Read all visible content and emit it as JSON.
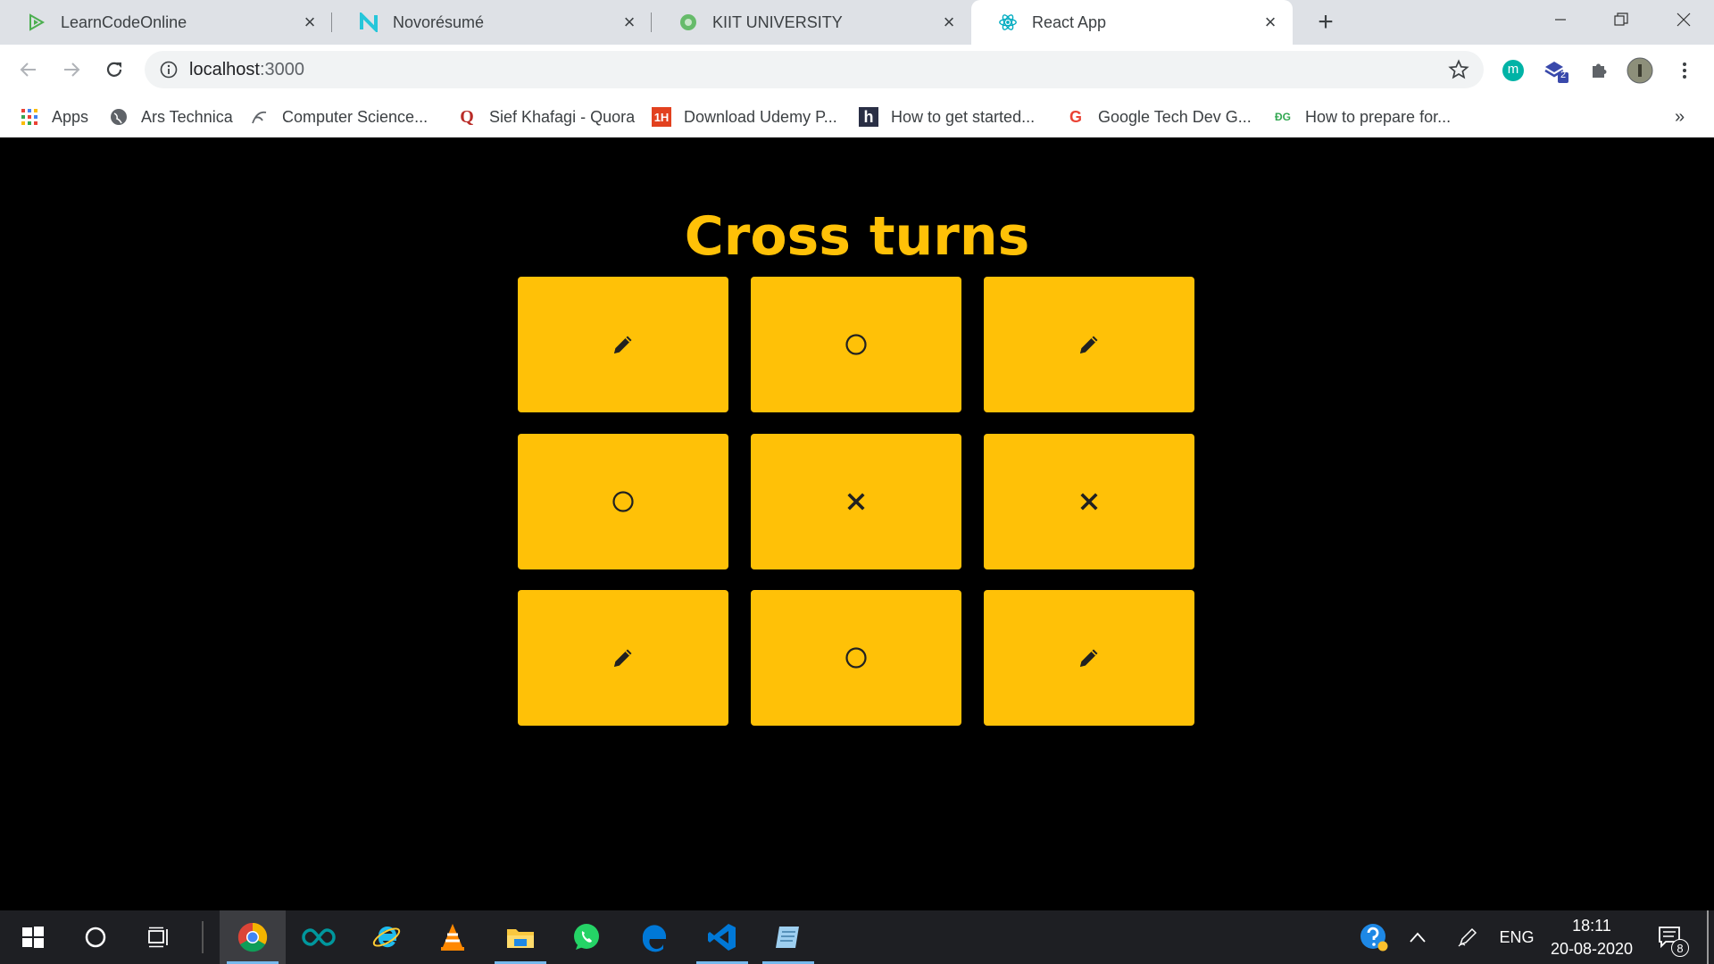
{
  "tabs": [
    {
      "title": "LearnCodeOnline",
      "icon": "learncodeonline-icon"
    },
    {
      "title": "Novorésumé",
      "icon": "novoresume-icon"
    },
    {
      "title": "KIIT UNIVERSITY",
      "icon": "kiit-icon"
    },
    {
      "title": "React App",
      "icon": "react-icon"
    }
  ],
  "address_bar": {
    "host": "localhost",
    "port": ":3000"
  },
  "extensions": {
    "badge": "2",
    "avatar_letter": "m"
  },
  "bookmarks": [
    {
      "label": "Apps"
    },
    {
      "label": "Ars Technica"
    },
    {
      "label": "Computer Science..."
    },
    {
      "label": "Sief Khafagi - Quora"
    },
    {
      "label": "Download Udemy P..."
    },
    {
      "label": "How to get started..."
    },
    {
      "label": "Google Tech Dev G..."
    },
    {
      "label": "How to prepare for..."
    }
  ],
  "bookmark_icon_text": {
    "udemy": "1H",
    "hashnode": "h",
    "google": "G",
    "devgrow": "ƉG",
    "quora": "Q"
  },
  "game": {
    "title": "Cross turns",
    "board": [
      "pencil",
      "circle",
      "pencil",
      "circle",
      "cross",
      "cross",
      "pencil",
      "circle",
      "pencil"
    ]
  },
  "taskbar": {
    "language": "ENG",
    "time": "18:11",
    "date": "20-08-2020",
    "notification_count": "8"
  },
  "colors": {
    "accent": "#ffc107",
    "background": "#000000"
  }
}
